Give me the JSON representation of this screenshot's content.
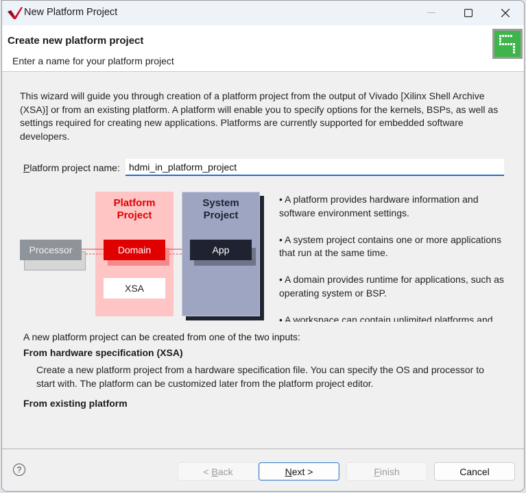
{
  "window": {
    "title": "New Platform Project",
    "controls": [
      "minimize",
      "maximize",
      "close"
    ]
  },
  "header": {
    "title": "Create new platform project",
    "subtitle": "Enter a name for your platform project",
    "icon": "platform-wizard-icon"
  },
  "intro_text": "This wizard will guide you through creation of a platform project from the output of Vivado [Xilinx Shell Archive (XSA)] or from an existing platform. A platform will enable you to specify options for the kernels, BSPs, as well as settings required for creating new applications. Platforms are currently supported for embedded software developers.",
  "name_field": {
    "label_prefix": "P",
    "label_rest": "latform project name:",
    "value": "hdmi_in_platform_project"
  },
  "diagram": {
    "processor": "Processor",
    "platform_title_1": "Platform",
    "platform_title_2": "Project",
    "domain": "Domain",
    "xsa": "XSA",
    "system_title_1": "System",
    "system_title_2": "Project",
    "app": "App",
    "colors": {
      "platform_bg": "#ffc4c4",
      "platform_text": "#e00000",
      "domain_bg": "#e00000",
      "system_bg": "#9ea5c3",
      "system_shadow": "#1f2433",
      "app_bg": "#1f2230",
      "processor_bg": "#8f939a"
    }
  },
  "bullets": [
    "• A platform provides hardware information and software environment settings.",
    "• A system project contains one or more applications that run at the same time.",
    "• A domain provides runtime for applications, such as operating system or BSP.",
    "• A workspace can contain unlimited platforms and"
  ],
  "inputs": {
    "intro": "A new platform project can be created from one of the two inputs:",
    "option1_title": "From hardware specification (XSA)",
    "option1_desc": "Create a new platform project from a hardware specification file. You can specify the OS and processor to start with. The platform can be customized later from the platform project editor.",
    "option2_title": "From existing platform"
  },
  "footer": {
    "help_icon": "?",
    "back": {
      "prefix": "< ",
      "mnemonic": "B",
      "rest": "ack"
    },
    "next": {
      "mnemonic": "N",
      "rest": "ext >"
    },
    "finish": {
      "mnemonic": "F",
      "rest": "inish"
    },
    "cancel": "Cancel"
  }
}
